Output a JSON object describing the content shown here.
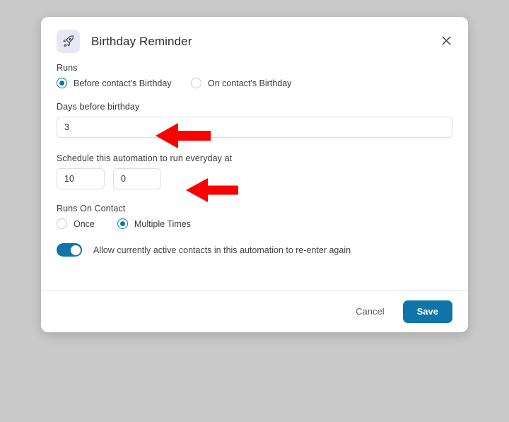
{
  "backdrop_color": "#c9c9c9",
  "dialog": {
    "title": "Birthday Reminder",
    "app_icon": "rocket-icon",
    "app_icon_bg": "#e8e7f7",
    "close_icon": "close-icon",
    "accent_color": "#0f74a8"
  },
  "runs": {
    "label": "Runs",
    "options": [
      {
        "label": "Before contact's Birthday",
        "selected": true
      },
      {
        "label": "On contact's Birthday",
        "selected": false
      }
    ]
  },
  "days_before": {
    "label": "Days before birthday",
    "value": "3",
    "placeholder": ""
  },
  "schedule": {
    "label": "Schedule this automation to run everyday at",
    "hour": {
      "value": "10",
      "placeholder": ""
    },
    "minute": {
      "value": "0",
      "placeholder": ""
    }
  },
  "runs_on_contact": {
    "label": "Runs On Contact",
    "options": [
      {
        "label": "Once",
        "selected": false
      },
      {
        "label": "Multiple Times",
        "selected": true
      }
    ]
  },
  "reenter": {
    "label": "Allow currently active contacts in this automation to re-enter again",
    "enabled": true
  },
  "footer": {
    "cancel_label": "Cancel",
    "save_label": "Save"
  },
  "annotations": {
    "color": "#fb0000",
    "arrows": [
      {
        "name": "arrow-days-before-input",
        "direction": "left"
      },
      {
        "name": "arrow-schedule-time-inputs",
        "direction": "left"
      }
    ]
  }
}
